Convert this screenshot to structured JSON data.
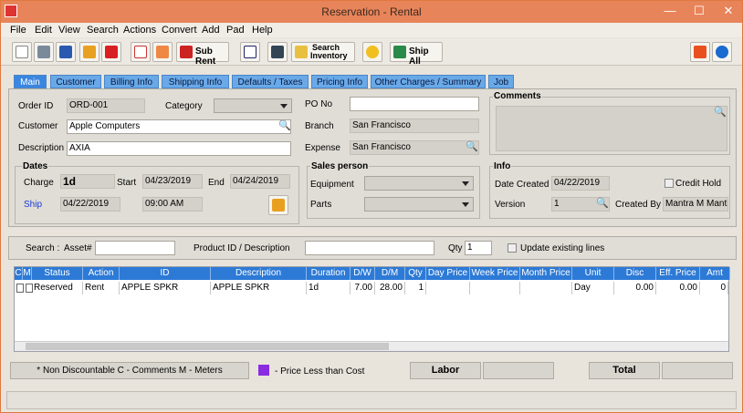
{
  "window": {
    "title": "Reservation - Rental"
  },
  "menu": [
    "File",
    "Edit",
    "View",
    "Search",
    "Actions",
    "Convert",
    "Add",
    "Pad",
    "Help"
  ],
  "toolbar": {
    "sub_rent": "Sub Rent",
    "search_inventory_1": "Search",
    "search_inventory_2": "Inventory",
    "ship_all": "Ship All"
  },
  "tabs": [
    "Main",
    "Customer",
    "Billing Info",
    "Shipping Info",
    "Defaults / Taxes",
    "Pricing Info",
    "Other Charges / Summary",
    "Job"
  ],
  "main": {
    "order_id_label": "Order ID",
    "order_id": "ORD-001",
    "category_label": "Category",
    "customer_label": "Customer",
    "customer": "Apple Computers",
    "description_label": "Description",
    "description": "AXIA",
    "po_label": "PO No",
    "po": "",
    "branch_label": "Branch",
    "branch": "San Francisco",
    "expense_label": "Expense",
    "expense": "San Francisco",
    "comments_label": "Comments",
    "dates_label": "Dates",
    "charge_label": "Charge",
    "charge": "1d",
    "start_label": "Start",
    "start": "04/23/2019",
    "end_label": "End",
    "end": "04/24/2019",
    "ship_label": "Ship",
    "ship_date": "04/22/2019",
    "ship_time": "09:00 AM",
    "salesperson_label": "Sales person",
    "equipment_label": "Equipment",
    "parts_label": "Parts",
    "info_label": "Info",
    "date_created_label": "Date Created",
    "date_created": "04/22/2019",
    "credit_hold_label": "Credit Hold",
    "version_label": "Version",
    "version": "1",
    "created_by_label": "Created By",
    "created_by": "Mantra M Mantra"
  },
  "search": {
    "label": "Search :",
    "asset_label": "Asset#",
    "product_label": "Product ID / Description",
    "qty_label": "Qty",
    "qty": "1",
    "update_label": "Update existing lines"
  },
  "grid": {
    "headers": [
      "C",
      "M",
      "Status",
      "Action",
      "ID",
      "Description",
      "Duration",
      "D/W",
      "D/M",
      "Qty",
      "Day Price",
      "Week Price",
      "Month Price",
      "Unit",
      "Disc",
      "Eff. Price",
      "Amt"
    ],
    "row": [
      "",
      "",
      "Reserved",
      "Rent",
      "APPLE SPKR",
      "APPLE SPKR",
      "1d",
      "7.00",
      "28.00",
      "1",
      "",
      "",
      "",
      "Day",
      "0.00",
      "0.00",
      "0"
    ]
  },
  "footer": {
    "legend": "* Non Discountable  C - Comments  M - Meters",
    "price_less": "- Price Less than Cost",
    "labor": "Labor",
    "total": "Total"
  },
  "colors": {
    "title": "#e8845a",
    "tab": "#6aa9e8",
    "grid_header": "#2d7ad6",
    "price_less": "#8a2be2"
  }
}
